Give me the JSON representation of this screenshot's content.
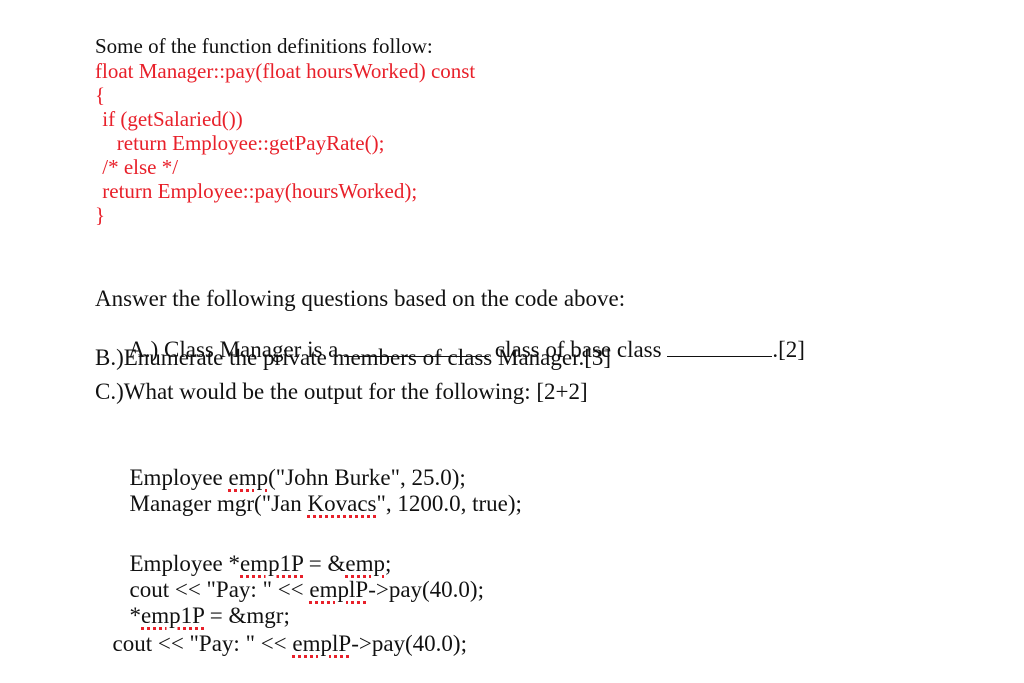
{
  "intro": "Some of the function definitions follow:",
  "code": {
    "color": "#e8202a",
    "lines": [
      "float Manager::pay(float hoursWorked) const",
      "{",
      " if (getSalaried())",
      "   return Employee::getPayRate();",
      " /* else */",
      " return Employee::pay(hoursWorked);",
      "}"
    ]
  },
  "questions": {
    "heading": "Answer the following questions based on the code above:",
    "a": {
      "prefix": "A.) Class Manager is a ",
      "middle": " class of base class ",
      "suffix": ".[2]"
    },
    "b": "B.)Enumerate the private members of class Manager.[3]",
    "c": "C.)What would be the output for the following: [2+2]"
  },
  "snippet1": {
    "line1": {
      "pre": "Employee ",
      "word": "emp",
      "post": "(\"John Burke\", 25.0);"
    },
    "line2": {
      "pre": "Manager mgr(\"Jan ",
      "word": "Kovacs",
      "post": "\", 1200.0, true);"
    }
  },
  "snippet2": {
    "line1": {
      "pre": "Employee *",
      "word1": "emp1P",
      "mid": " = &",
      "word2": "emp",
      "post": ";"
    },
    "line2": {
      "pre": "cout << \"Pay: \" << ",
      "word": "emplP",
      "post": "->pay(40.0);"
    },
    "line3": {
      "pre": "*",
      "word": "emp1P",
      "post": " = &mgr;"
    },
    "line4": {
      "pre": "cout << \"Pay: \" << ",
      "word": "emplP",
      "post": "->pay(40.0);"
    }
  }
}
